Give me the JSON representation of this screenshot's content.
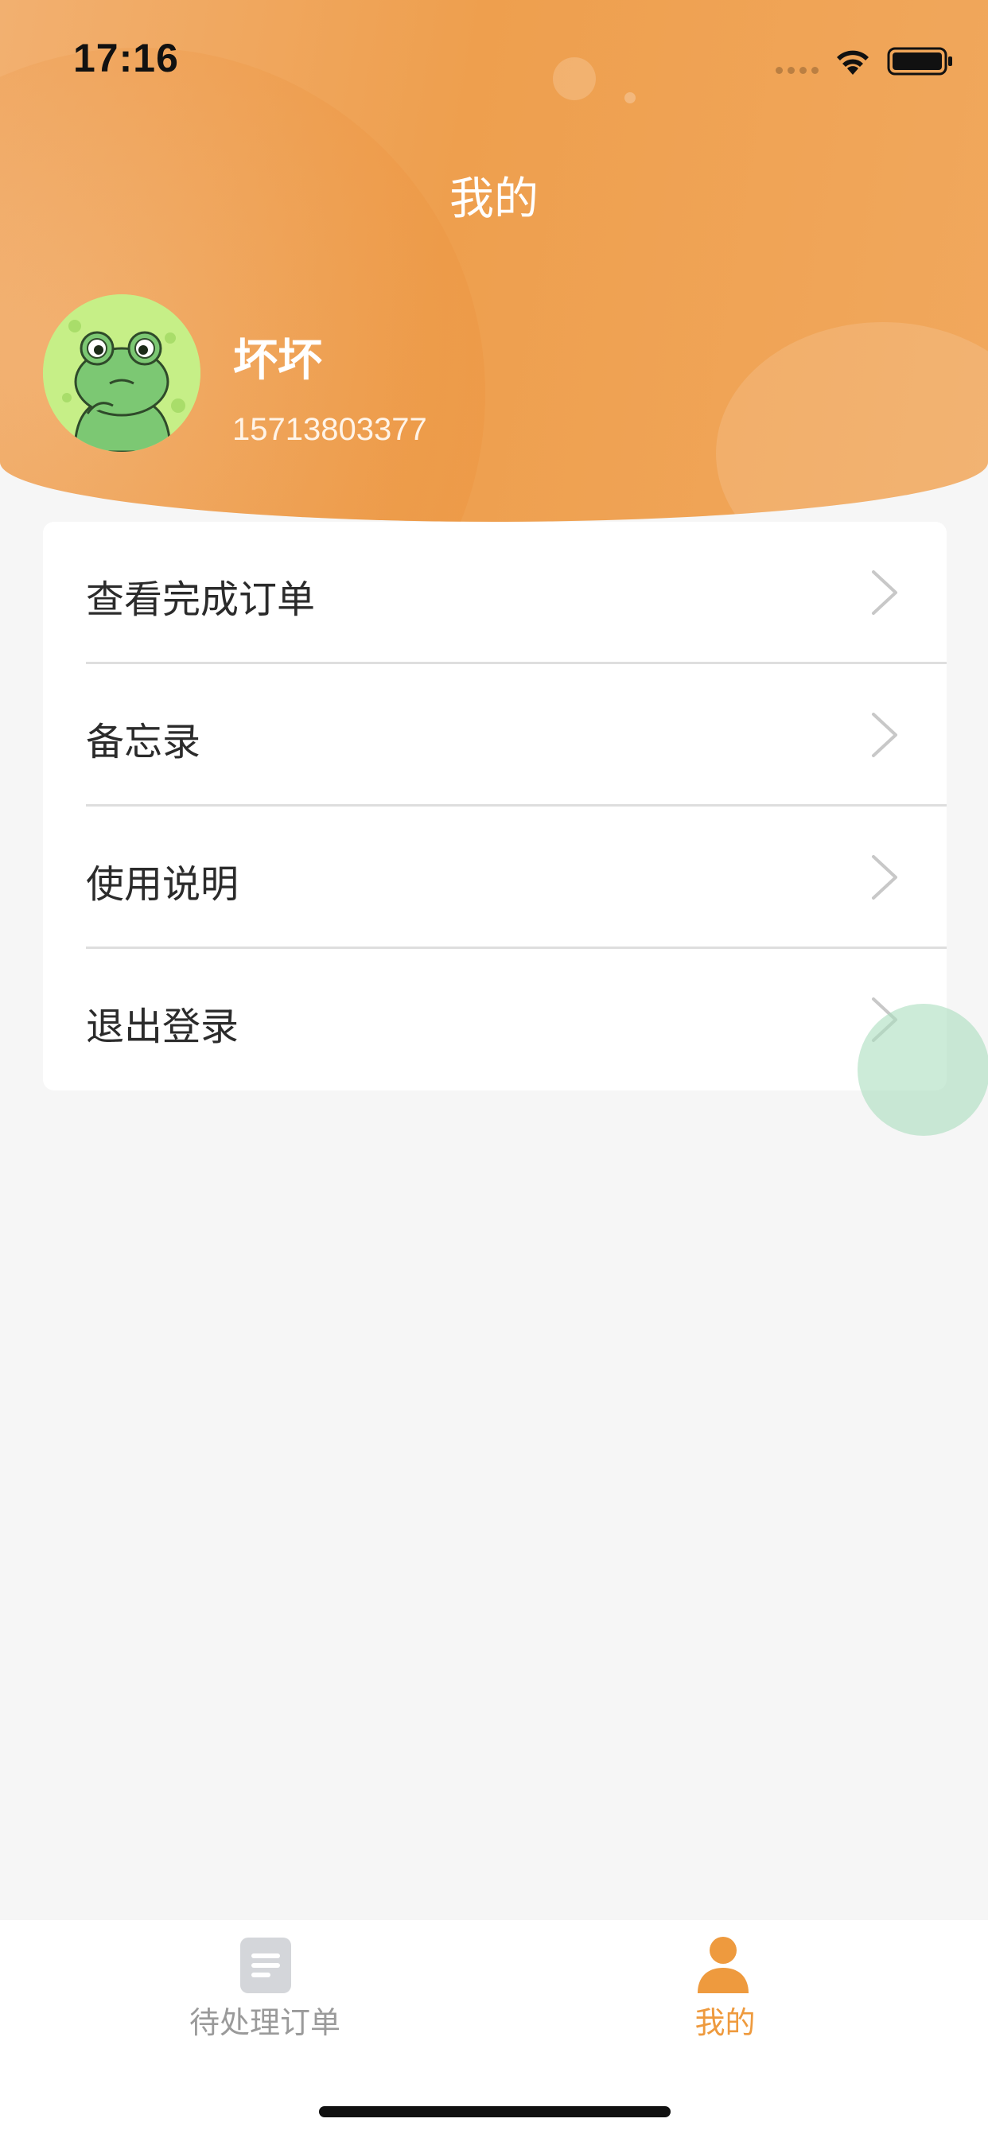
{
  "status_bar": {
    "time": "17:16"
  },
  "header": {
    "title": "我的",
    "accent_color": "#ee9f4e"
  },
  "profile": {
    "name": "坏坏",
    "phone": "15713803377",
    "avatar_icon": "frog-avatar-icon"
  },
  "menu": {
    "items": [
      {
        "label": "查看完成订单",
        "icon": "chevron-right-icon"
      },
      {
        "label": "备忘录",
        "icon": "chevron-right-icon"
      },
      {
        "label": "使用说明",
        "icon": "chevron-right-icon"
      },
      {
        "label": "退出登录",
        "icon": "chevron-right-icon"
      }
    ]
  },
  "tab_bar": {
    "tabs": [
      {
        "label": "待处理订单",
        "icon": "document-icon",
        "active": false,
        "color": "#9a9a9a"
      },
      {
        "label": "我的",
        "icon": "person-icon",
        "active": true,
        "color": "#ee9a3e"
      }
    ]
  }
}
